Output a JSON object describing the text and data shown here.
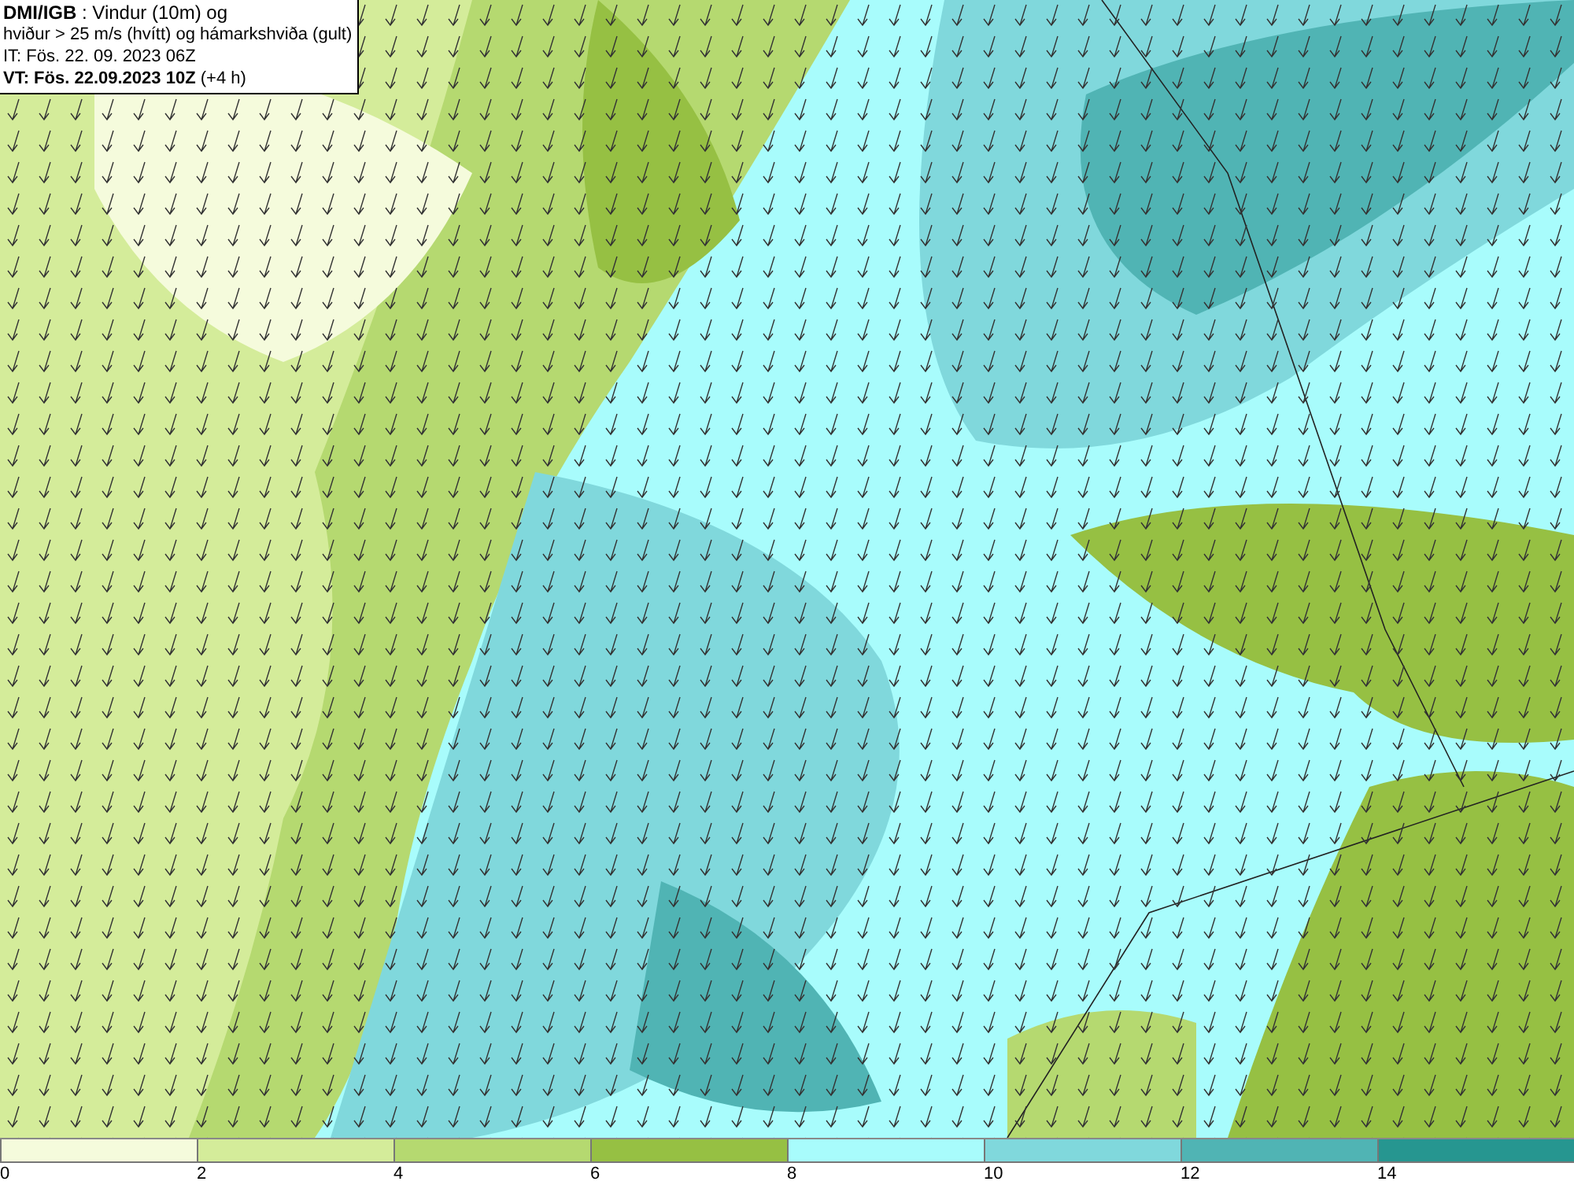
{
  "map": {
    "info": [
      "**DMI/IGB** : Vindur (10m) og",
      "hviður > 25 m/s (hvítt) og hámarkshviða (gult)",
      "IT: Fös. 22. 09. 2023 06Z",
      "**VT: Fös. 22.09.2023 10Z** (+4 h)"
    ]
  },
  "legend": [
    {
      "label": "0",
      "color": "#f5fbdc"
    },
    {
      "label": "2",
      "color": "#d4ec9a"
    },
    {
      "label": "4",
      "color": "#b5d970"
    },
    {
      "label": "6",
      "color": "#96c043"
    },
    {
      "label": "8",
      "color": "#a8fcfc"
    },
    {
      "label": "10",
      "color": "#80d8dc"
    },
    {
      "label": "12",
      "color": "#50b4b4"
    },
    {
      "label": "14",
      "color": "#269690"
    }
  ]
}
